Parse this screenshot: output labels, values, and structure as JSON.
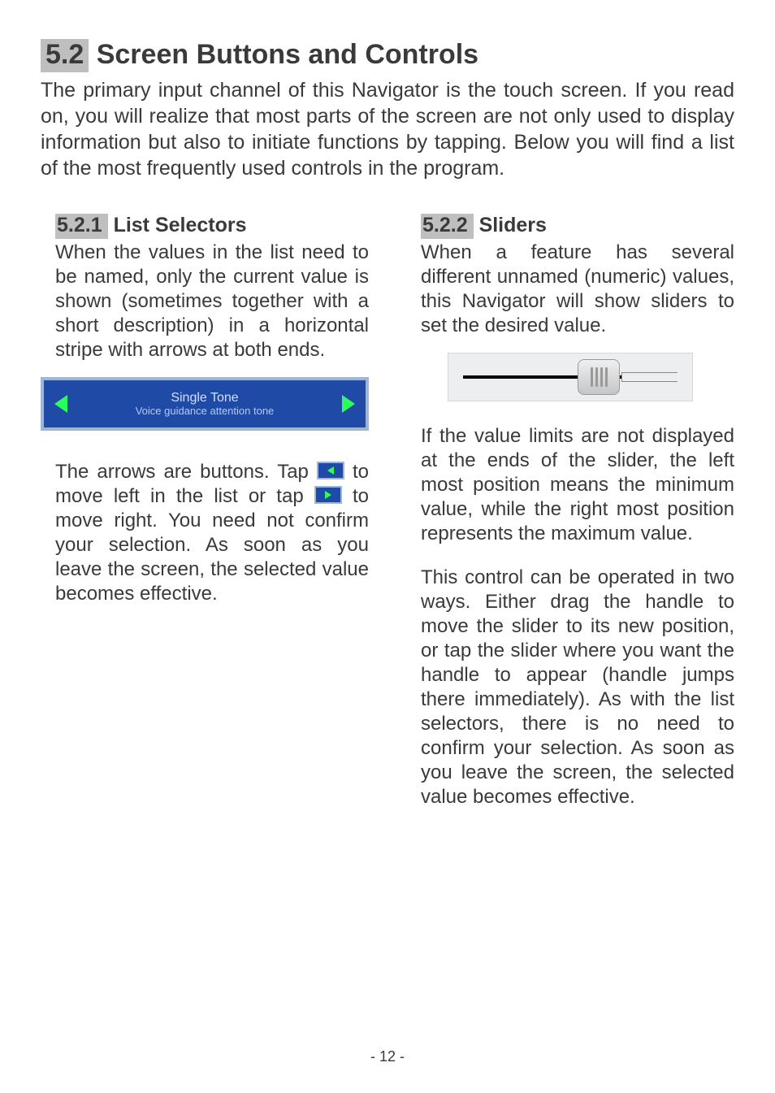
{
  "section": {
    "h2_number": "5.2",
    "h2_title": "Screen Buttons and Controls",
    "intro": "The primary input channel of this Navigator is the touch screen. If you read on, you will realize that most parts of the screen are not only used to display information but also to initiate functions by tapping. Below you will find a list of the most frequently used controls in the program."
  },
  "left": {
    "h3_number": "5.2.1",
    "h3_title": "List Selectors",
    "para1": "When the values in the list need to be named, only the current value is shown (sometimes together with a short description) in a horizontal stripe with arrows at both ends.",
    "figure": {
      "title": "Single Tone",
      "subtitle": "Voice guidance attention tone"
    },
    "para2_a": "The arrows are buttons. Tap ",
    "para2_b": " to move left in the list or tap ",
    "para2_c": " to move right. You need not confirm your selection. As soon as you leave the screen, the selected value becomes effective."
  },
  "right": {
    "h3_number": "5.2.2",
    "h3_title": "Sliders",
    "para1": "When a feature has several different unnamed (numeric) values, this Navigator will show sliders to set the desired value.",
    "para2": "If the value limits are not displayed at the ends of the slider, the left most position means the minimum value, while the right most position represents the maximum value.",
    "para3": "This control can be operated in two ways. Either drag the handle to move the slider to its new position, or tap the slider where you want the handle to appear (handle jumps there immediately). As with the list selectors, there is no need to confirm your selection. As soon as you leave the screen, the selected value becomes effective."
  },
  "page_number": "- 12 -"
}
